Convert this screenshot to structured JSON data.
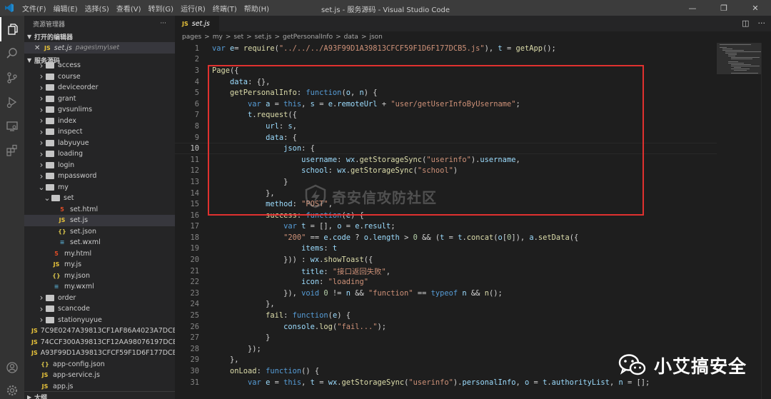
{
  "titlebar": {
    "menu": [
      "文件(F)",
      "编辑(E)",
      "选择(S)",
      "查看(V)",
      "转到(G)",
      "运行(R)",
      "终端(T)",
      "帮助(H)"
    ],
    "title": "set.js - 服务源码 - Visual Studio Code"
  },
  "sidebar": {
    "header": "资源管理器",
    "more": "···",
    "open_editors_label": "打开的编辑器",
    "open_editor": {
      "name": "set.js",
      "path": "pages\\my\\set"
    },
    "project_label": "服务源码",
    "tree": [
      {
        "label": "access",
        "kind": "folder",
        "indent": 1
      },
      {
        "label": "course",
        "kind": "folder",
        "indent": 1
      },
      {
        "label": "deviceorder",
        "kind": "folder",
        "indent": 1
      },
      {
        "label": "grant",
        "kind": "folder",
        "indent": 1
      },
      {
        "label": "gvsunlims",
        "kind": "folder",
        "indent": 1
      },
      {
        "label": "index",
        "kind": "folder",
        "indent": 1
      },
      {
        "label": "inspect",
        "kind": "folder",
        "indent": 1
      },
      {
        "label": "labyuyue",
        "kind": "folder",
        "indent": 1
      },
      {
        "label": "loading",
        "kind": "folder",
        "indent": 1
      },
      {
        "label": "login",
        "kind": "folder",
        "indent": 1
      },
      {
        "label": "mpassword",
        "kind": "folder",
        "indent": 1
      },
      {
        "label": "my",
        "kind": "folder-open",
        "indent": 1
      },
      {
        "label": "set",
        "kind": "folder-open",
        "indent": 2
      },
      {
        "label": "set.html",
        "kind": "html",
        "indent": 3
      },
      {
        "label": "set.js",
        "kind": "js",
        "indent": 3,
        "selected": true
      },
      {
        "label": "set.json",
        "kind": "json",
        "indent": 3
      },
      {
        "label": "set.wxml",
        "kind": "wxml",
        "indent": 3
      },
      {
        "label": "my.html",
        "kind": "html",
        "indent": 2
      },
      {
        "label": "my.js",
        "kind": "js",
        "indent": 2
      },
      {
        "label": "my.json",
        "kind": "json",
        "indent": 2
      },
      {
        "label": "my.wxml",
        "kind": "wxml",
        "indent": 2
      },
      {
        "label": "order",
        "kind": "folder",
        "indent": 1
      },
      {
        "label": "scancode",
        "kind": "folder",
        "indent": 1
      },
      {
        "label": "stationyuyue",
        "kind": "folder",
        "indent": 1
      },
      {
        "label": "7C9E0247A39813CF1AF86A4023A7DCB5...",
        "kind": "js",
        "indent": 0
      },
      {
        "label": "74CCF300A39813CF12AA98076197DCB5...",
        "kind": "js",
        "indent": 0
      },
      {
        "label": "A93F99D1A39813CFCF59F1D6F177DCB5...",
        "kind": "js",
        "indent": 0
      },
      {
        "label": "app-config.json",
        "kind": "json",
        "indent": 0
      },
      {
        "label": "app-service.js",
        "kind": "js",
        "indent": 0
      },
      {
        "label": "app.js",
        "kind": "js",
        "indent": 0
      }
    ],
    "outline_label": "大纲"
  },
  "editor": {
    "tab_label": "set.js",
    "tab_badge": "JS",
    "breadcrumb": [
      "pages",
      "my",
      "set",
      "set.js",
      "getPersonalInfo",
      "data",
      "json"
    ],
    "breadcrumb_sep": ">",
    "current_line": 10,
    "code": [
      [
        [
          "kw",
          "var "
        ],
        [
          "vr",
          "e"
        ],
        [
          "",
          "= "
        ],
        [
          "fn",
          "require"
        ],
        [
          "",
          "("
        ],
        [
          "st",
          "\"../../../A93F99D1A39813CFCF59F1D6F177DCB5.js\""
        ],
        [
          "",
          "), "
        ],
        [
          "vr",
          "t"
        ],
        [
          "",
          " = "
        ],
        [
          "fn",
          "getApp"
        ],
        [
          "",
          "();"
        ]
      ],
      [],
      [
        [
          "fn",
          "Page"
        ],
        [
          "",
          "({"
        ]
      ],
      [
        [
          "",
          "    "
        ],
        [
          "vr",
          "data"
        ],
        [
          "",
          ": {},"
        ]
      ],
      [
        [
          "",
          "    "
        ],
        [
          "fn",
          "getPersonalInfo"
        ],
        [
          "",
          ": "
        ],
        [
          "kw",
          "function"
        ],
        [
          "",
          "("
        ],
        [
          "vr",
          "o"
        ],
        [
          "",
          ", "
        ],
        [
          "vr",
          "n"
        ],
        [
          "",
          ") {"
        ]
      ],
      [
        [
          "",
          "        "
        ],
        [
          "kw",
          "var "
        ],
        [
          "vr",
          "a"
        ],
        [
          "",
          " = "
        ],
        [
          "kw",
          "this"
        ],
        [
          "",
          ", "
        ],
        [
          "vr",
          "s"
        ],
        [
          "",
          " = "
        ],
        [
          "vr",
          "e"
        ],
        [
          "",
          "."
        ],
        [
          "vr",
          "remoteUrl"
        ],
        [
          "",
          " + "
        ],
        [
          "st",
          "\"user/getUserInfoByUsername\""
        ],
        [
          "",
          ";"
        ]
      ],
      [
        [
          "",
          "        "
        ],
        [
          "vr",
          "t"
        ],
        [
          "",
          "."
        ],
        [
          "fn",
          "request"
        ],
        [
          "",
          "({"
        ]
      ],
      [
        [
          "",
          "            "
        ],
        [
          "vr",
          "url"
        ],
        [
          "",
          ": "
        ],
        [
          "vr",
          "s"
        ],
        [
          "",
          ","
        ]
      ],
      [
        [
          "",
          "            "
        ],
        [
          "vr",
          "data"
        ],
        [
          "",
          ": {"
        ]
      ],
      [
        [
          "",
          "                "
        ],
        [
          "vr",
          "json"
        ],
        [
          "",
          ": {"
        ]
      ],
      [
        [
          "",
          "                    "
        ],
        [
          "vr",
          "username"
        ],
        [
          "",
          ": "
        ],
        [
          "vr",
          "wx"
        ],
        [
          "",
          "."
        ],
        [
          "fn",
          "getStorageSync"
        ],
        [
          "",
          "("
        ],
        [
          "st",
          "\"userinfo\""
        ],
        [
          "",
          ")."
        ],
        [
          "vr",
          "username"
        ],
        [
          "",
          ","
        ]
      ],
      [
        [
          "",
          "                    "
        ],
        [
          "vr",
          "school"
        ],
        [
          "",
          ": "
        ],
        [
          "vr",
          "wx"
        ],
        [
          "",
          "."
        ],
        [
          "fn",
          "getStorageSync"
        ],
        [
          "",
          "("
        ],
        [
          "st",
          "\"school\""
        ],
        [
          "",
          ")"
        ]
      ],
      [
        [
          "",
          "                }"
        ]
      ],
      [
        [
          "",
          "            },"
        ]
      ],
      [
        [
          "",
          "            "
        ],
        [
          "vr",
          "method"
        ],
        [
          "",
          ": "
        ],
        [
          "st",
          "\"POST\""
        ],
        [
          "",
          ","
        ]
      ],
      [
        [
          "",
          "            "
        ],
        [
          "fn",
          "success"
        ],
        [
          "",
          ": "
        ],
        [
          "kw",
          "function"
        ],
        [
          "",
          "("
        ],
        [
          "vr",
          "e"
        ],
        [
          "",
          ") {"
        ]
      ],
      [
        [
          "",
          "                "
        ],
        [
          "kw",
          "var "
        ],
        [
          "vr",
          "t"
        ],
        [
          "",
          " = [], "
        ],
        [
          "vr",
          "o"
        ],
        [
          "",
          " = "
        ],
        [
          "vr",
          "e"
        ],
        [
          "",
          "."
        ],
        [
          "vr",
          "result"
        ],
        [
          "",
          ";"
        ]
      ],
      [
        [
          "",
          "                "
        ],
        [
          "st",
          "\"200\""
        ],
        [
          "",
          " == "
        ],
        [
          "vr",
          "e"
        ],
        [
          "",
          "."
        ],
        [
          "vr",
          "code"
        ],
        [
          "",
          " ? "
        ],
        [
          "vr",
          "o"
        ],
        [
          "",
          "."
        ],
        [
          "vr",
          "length"
        ],
        [
          "",
          " > "
        ],
        [
          "nm",
          "0"
        ],
        [
          "",
          " && ("
        ],
        [
          "vr",
          "t"
        ],
        [
          "",
          " = "
        ],
        [
          "vr",
          "t"
        ],
        [
          "",
          "."
        ],
        [
          "fn",
          "concat"
        ],
        [
          "",
          "("
        ],
        [
          "vr",
          "o"
        ],
        [
          "",
          "["
        ],
        [
          "nm",
          "0"
        ],
        [
          "",
          "]), "
        ],
        [
          "vr",
          "a"
        ],
        [
          "",
          "."
        ],
        [
          "fn",
          "setData"
        ],
        [
          "",
          "({"
        ]
      ],
      [
        [
          "",
          "                    "
        ],
        [
          "vr",
          "items"
        ],
        [
          "",
          ": "
        ],
        [
          "vr",
          "t"
        ]
      ],
      [
        [
          "",
          "                })) : "
        ],
        [
          "vr",
          "wx"
        ],
        [
          "",
          "."
        ],
        [
          "fn",
          "showToast"
        ],
        [
          "",
          "({"
        ]
      ],
      [
        [
          "",
          "                    "
        ],
        [
          "vr",
          "title"
        ],
        [
          "",
          ": "
        ],
        [
          "st",
          "\"接口返回失败\""
        ],
        [
          "",
          ","
        ]
      ],
      [
        [
          "",
          "                    "
        ],
        [
          "vr",
          "icon"
        ],
        [
          "",
          ": "
        ],
        [
          "st",
          "\"loading\""
        ]
      ],
      [
        [
          "",
          "                }), "
        ],
        [
          "kw",
          "void "
        ],
        [
          "nm",
          "0"
        ],
        [
          "",
          " != "
        ],
        [
          "vr",
          "n"
        ],
        [
          "",
          " && "
        ],
        [
          "st",
          "\"function\""
        ],
        [
          "",
          " == "
        ],
        [
          "kw",
          "typeof "
        ],
        [
          "vr",
          "n"
        ],
        [
          "",
          " && "
        ],
        [
          "fn",
          "n"
        ],
        [
          "",
          "();"
        ]
      ],
      [
        [
          "",
          "            },"
        ]
      ],
      [
        [
          "",
          "            "
        ],
        [
          "fn",
          "fail"
        ],
        [
          "",
          ": "
        ],
        [
          "kw",
          "function"
        ],
        [
          "",
          "("
        ],
        [
          "vr",
          "e"
        ],
        [
          "",
          ") {"
        ]
      ],
      [
        [
          "",
          "                "
        ],
        [
          "vr",
          "console"
        ],
        [
          "",
          "."
        ],
        [
          "fn",
          "log"
        ],
        [
          "",
          "("
        ],
        [
          "st",
          "\"fail...\""
        ],
        [
          "",
          ");"
        ]
      ],
      [
        [
          "",
          "            }"
        ]
      ],
      [
        [
          "",
          "        });"
        ]
      ],
      [
        [
          "",
          "    },"
        ]
      ],
      [
        [
          "",
          "    "
        ],
        [
          "fn",
          "onLoad"
        ],
        [
          "",
          ": "
        ],
        [
          "kw",
          "function"
        ],
        [
          "",
          "() {"
        ]
      ],
      [
        [
          "",
          "        "
        ],
        [
          "kw",
          "var "
        ],
        [
          "vr",
          "e"
        ],
        [
          "",
          " = "
        ],
        [
          "kw",
          "this"
        ],
        [
          "",
          ", "
        ],
        [
          "vr",
          "t"
        ],
        [
          "",
          " = "
        ],
        [
          "vr",
          "wx"
        ],
        [
          "",
          "."
        ],
        [
          "fn",
          "getStorageSync"
        ],
        [
          "",
          "("
        ],
        [
          "st",
          "\"userinfo\""
        ],
        [
          "",
          ")."
        ],
        [
          "vr",
          "personalInfo"
        ],
        [
          "",
          ", "
        ],
        [
          "vr",
          "o"
        ],
        [
          "",
          " = "
        ],
        [
          "vr",
          "t"
        ],
        [
          "",
          "."
        ],
        [
          "vr",
          "authorityList"
        ],
        [
          "",
          ", "
        ],
        [
          "vr",
          "n"
        ],
        [
          "",
          " = [];"
        ]
      ]
    ]
  },
  "overlay": {
    "watermark_text": "奇安信攻防社区",
    "brand_text": "小艾搞安全"
  },
  "colors": {
    "highlight_box": "#e0312f",
    "keyword": "#569cd6",
    "string": "#ce9178",
    "function": "#dcdcaa",
    "variable": "#9cdcfe"
  }
}
